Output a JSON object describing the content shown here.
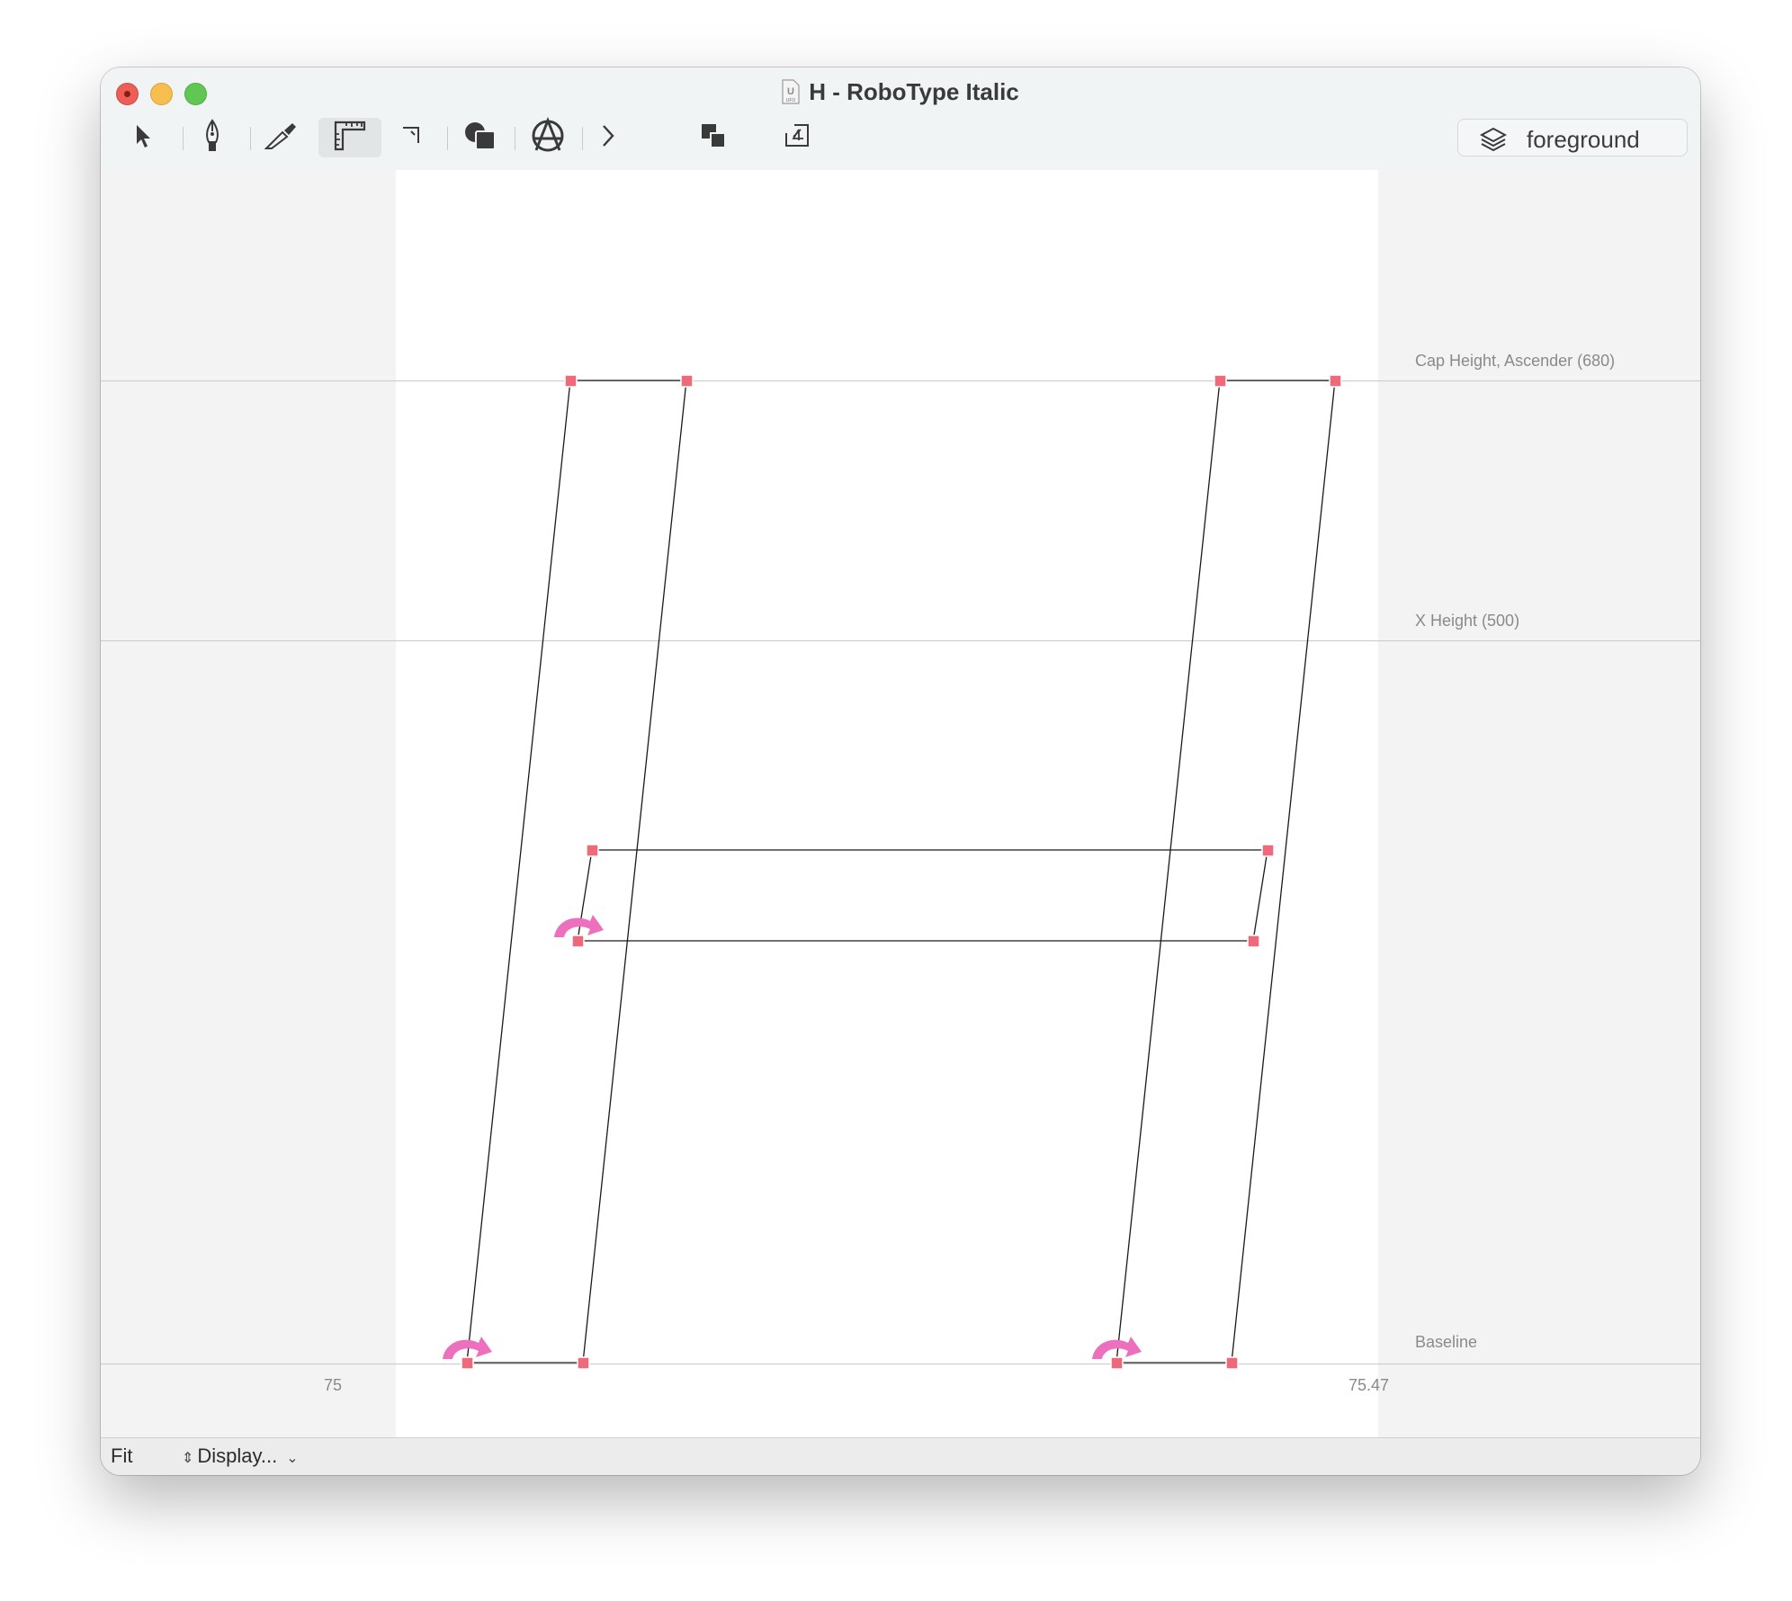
{
  "window": {
    "title": "H - RoboType Italic",
    "file_badge": "U",
    "file_badge_sub": "UFO"
  },
  "toolbar": {
    "tools": [
      {
        "name": "pointer-tool-icon"
      },
      {
        "name": "bezier-pen-tool-icon"
      },
      {
        "name": "knife-tool-icon"
      },
      {
        "name": "ruler-tool-icon",
        "active": true
      },
      {
        "name": "corner-tool-icon"
      },
      {
        "name": "shapes-tool-icon"
      },
      {
        "name": "anarchy-tool-icon"
      },
      {
        "name": "chevron-right-icon"
      },
      {
        "name": "layers-overlap-icon"
      },
      {
        "name": "export-icon"
      }
    ],
    "layer_label": "foreground"
  },
  "guides": {
    "cap_height": "Cap Height, Ascender (680)",
    "x_height": "X Height (500)",
    "baseline": "Baseline"
  },
  "sidebearings": {
    "left": "75",
    "right": "75.47"
  },
  "bottom": {
    "zoom": "Fit",
    "display": "Display..."
  },
  "colors": {
    "point": "#ee6a7a",
    "start_arrow": "#ec70be",
    "outline": "#1a1a1a"
  }
}
